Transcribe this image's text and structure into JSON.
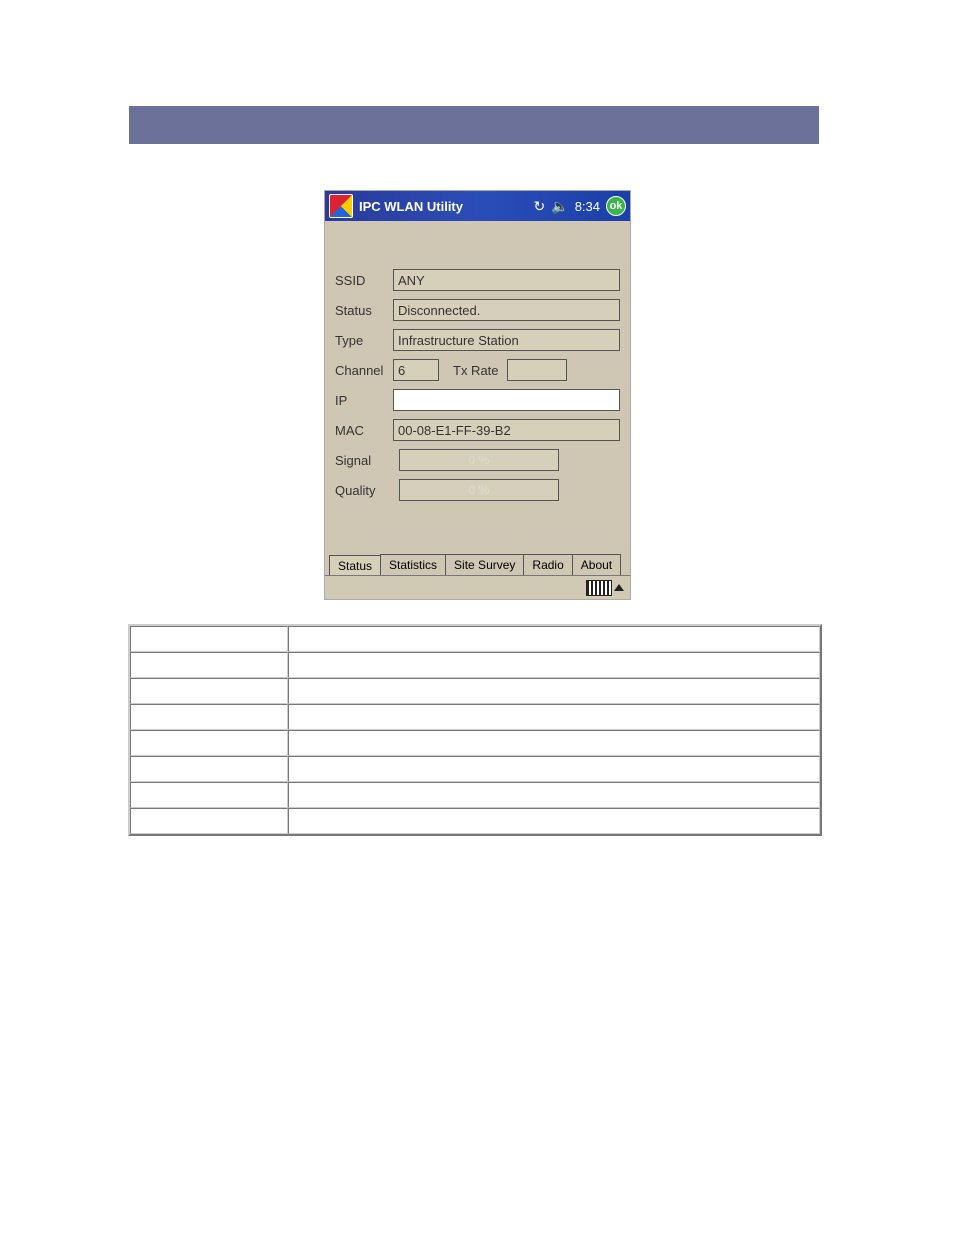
{
  "titlebar": {
    "app_title": "IPC WLAN Utility",
    "time": "8:34",
    "ok_label": "ok"
  },
  "form": {
    "ssid_label": "SSID",
    "ssid_value": "ANY",
    "status_label": "Status",
    "status_value": "Disconnected.",
    "type_label": "Type",
    "type_value": "Infrastructure Station",
    "channel_label": "Channel",
    "channel_value": "6",
    "txrate_label": "Tx Rate",
    "txrate_value": "",
    "ip_label": "IP",
    "ip_value": "",
    "mac_label": "MAC",
    "mac_value": "00-08-E1-FF-39-B2",
    "signal_label": "Signal",
    "signal_value": "0 %",
    "quality_label": "Quality",
    "quality_value": "0 %"
  },
  "tabs": {
    "status": "Status",
    "statistics": "Statistics",
    "site_survey": "Site Survey",
    "radio": "Radio",
    "about": "About"
  },
  "desc_rows": [
    {
      "k": "",
      "v": ""
    },
    {
      "k": "",
      "v": ""
    },
    {
      "k": "",
      "v": ""
    },
    {
      "k": "",
      "v": ""
    },
    {
      "k": "",
      "v": ""
    },
    {
      "k": "",
      "v": ""
    },
    {
      "k": "",
      "v": ""
    },
    {
      "k": "",
      "v": ""
    }
  ]
}
